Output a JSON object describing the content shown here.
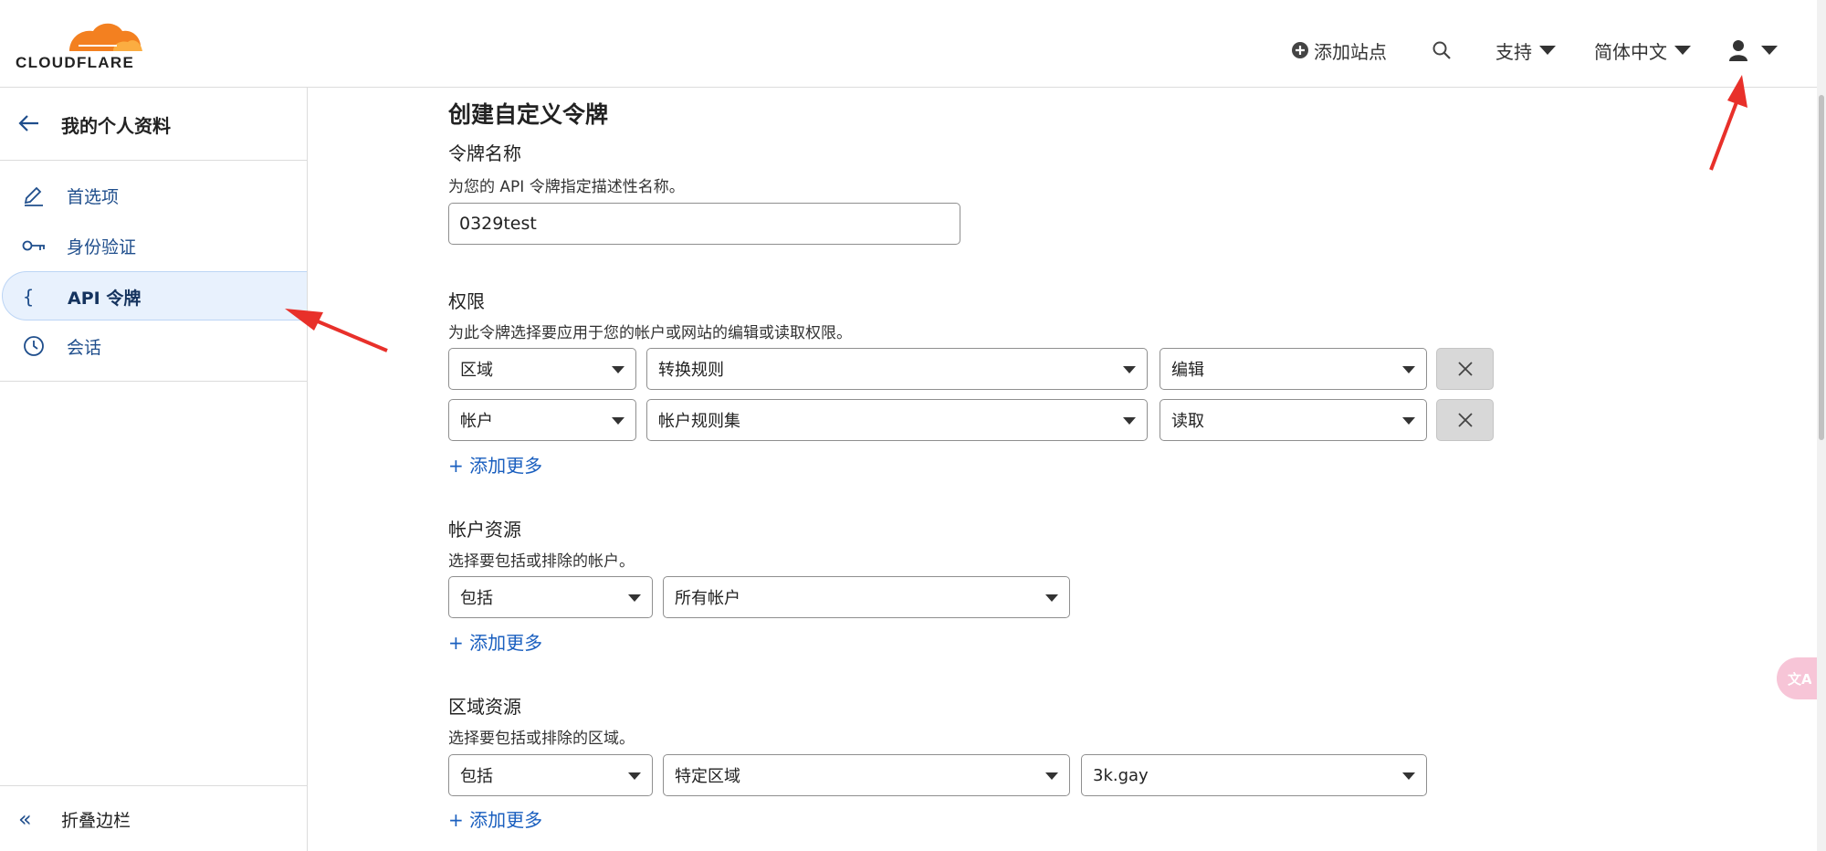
{
  "header": {
    "logo_text": "CLOUDFLARE",
    "add_site_label": "添加站点",
    "support_label": "支持",
    "language_label": "简体中文"
  },
  "sidebar": {
    "back_title": "我的个人资料",
    "items": [
      {
        "label": "首选项",
        "icon": "pencil-icon"
      },
      {
        "label": "身份验证",
        "icon": "key-icon"
      },
      {
        "label": "API 令牌",
        "icon": "braces-icon",
        "active": true
      },
      {
        "label": "会话",
        "icon": "clock-icon"
      }
    ],
    "collapse_label": "折叠边栏"
  },
  "main": {
    "title": "创建自定义令牌",
    "token_name": {
      "title": "令牌名称",
      "desc": "为您的 API 令牌指定描述性名称。",
      "value": "0329test"
    },
    "permissions": {
      "title": "权限",
      "desc": "为此令牌选择要应用于您的帐户或网站的编辑或读取权限。",
      "rows": [
        {
          "scope": "区域",
          "item": "转换规则",
          "access": "编辑"
        },
        {
          "scope": "帐户",
          "item": "帐户规则集",
          "access": "读取"
        }
      ],
      "add_more": "+ 添加更多"
    },
    "account_resources": {
      "title": "帐户资源",
      "desc": "选择要包括或排除的帐户。",
      "include": "包括",
      "target": "所有帐户",
      "add_more": "+ 添加更多"
    },
    "zone_resources": {
      "title": "区域资源",
      "desc": "选择要包括或排除的区域。",
      "include": "包括",
      "target": "特定区域",
      "zone": "3k.gay",
      "add_more": "+ 添加更多"
    }
  },
  "colors": {
    "brand_orange": "#f38020",
    "link_blue": "#1a5fbf",
    "sidebar_active_bg": "#e8f1fd",
    "annotation_red": "#e8302a"
  }
}
